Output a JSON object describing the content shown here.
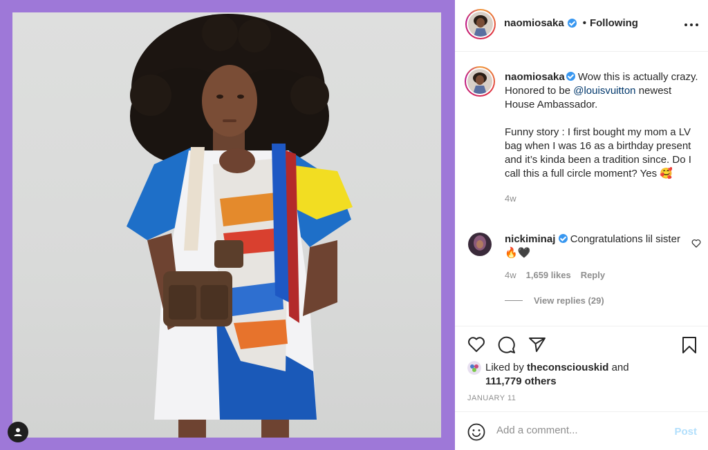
{
  "post": {
    "author": "naomiosaka",
    "follow_separator": "•",
    "follow_label": "Following",
    "caption_part1": " Wow this is actually crazy. Honored to be ",
    "caption_mention": "@louisvuitton",
    "caption_part2": " newest House Ambassador.",
    "caption_part3": "Funny story : I first bought my mom a LV bag when I was 16 as a birthday present and it’s kinda been a tradition since. Do I call this a full circle moment? Yes 🥰",
    "caption_time": "4w"
  },
  "comment": {
    "author": "nickiminaj",
    "text": " Congratulations lil sister 🔥🖤",
    "time": "4w",
    "likes": "1,659 likes",
    "reply_label": "Reply",
    "view_replies": "View replies (29)"
  },
  "likes": {
    "prefix": "Liked by ",
    "user": "theconsciouskid",
    "suffix": " and",
    "others": "111,779 others"
  },
  "date": "JANUARY 11",
  "comment_box": {
    "placeholder": "Add a comment...",
    "post_label": "Post"
  },
  "colors": {
    "frame": "#9e78d8",
    "link": "#00376b",
    "muted": "#8e8e8e",
    "verified": "#3897f0",
    "post_disabled": "#b2dffc"
  },
  "icons": [
    "user-tag-icon",
    "verified-icon",
    "more-options-icon",
    "heart-icon",
    "comment-icon",
    "share-icon",
    "bookmark-icon",
    "emoji-icon"
  ]
}
